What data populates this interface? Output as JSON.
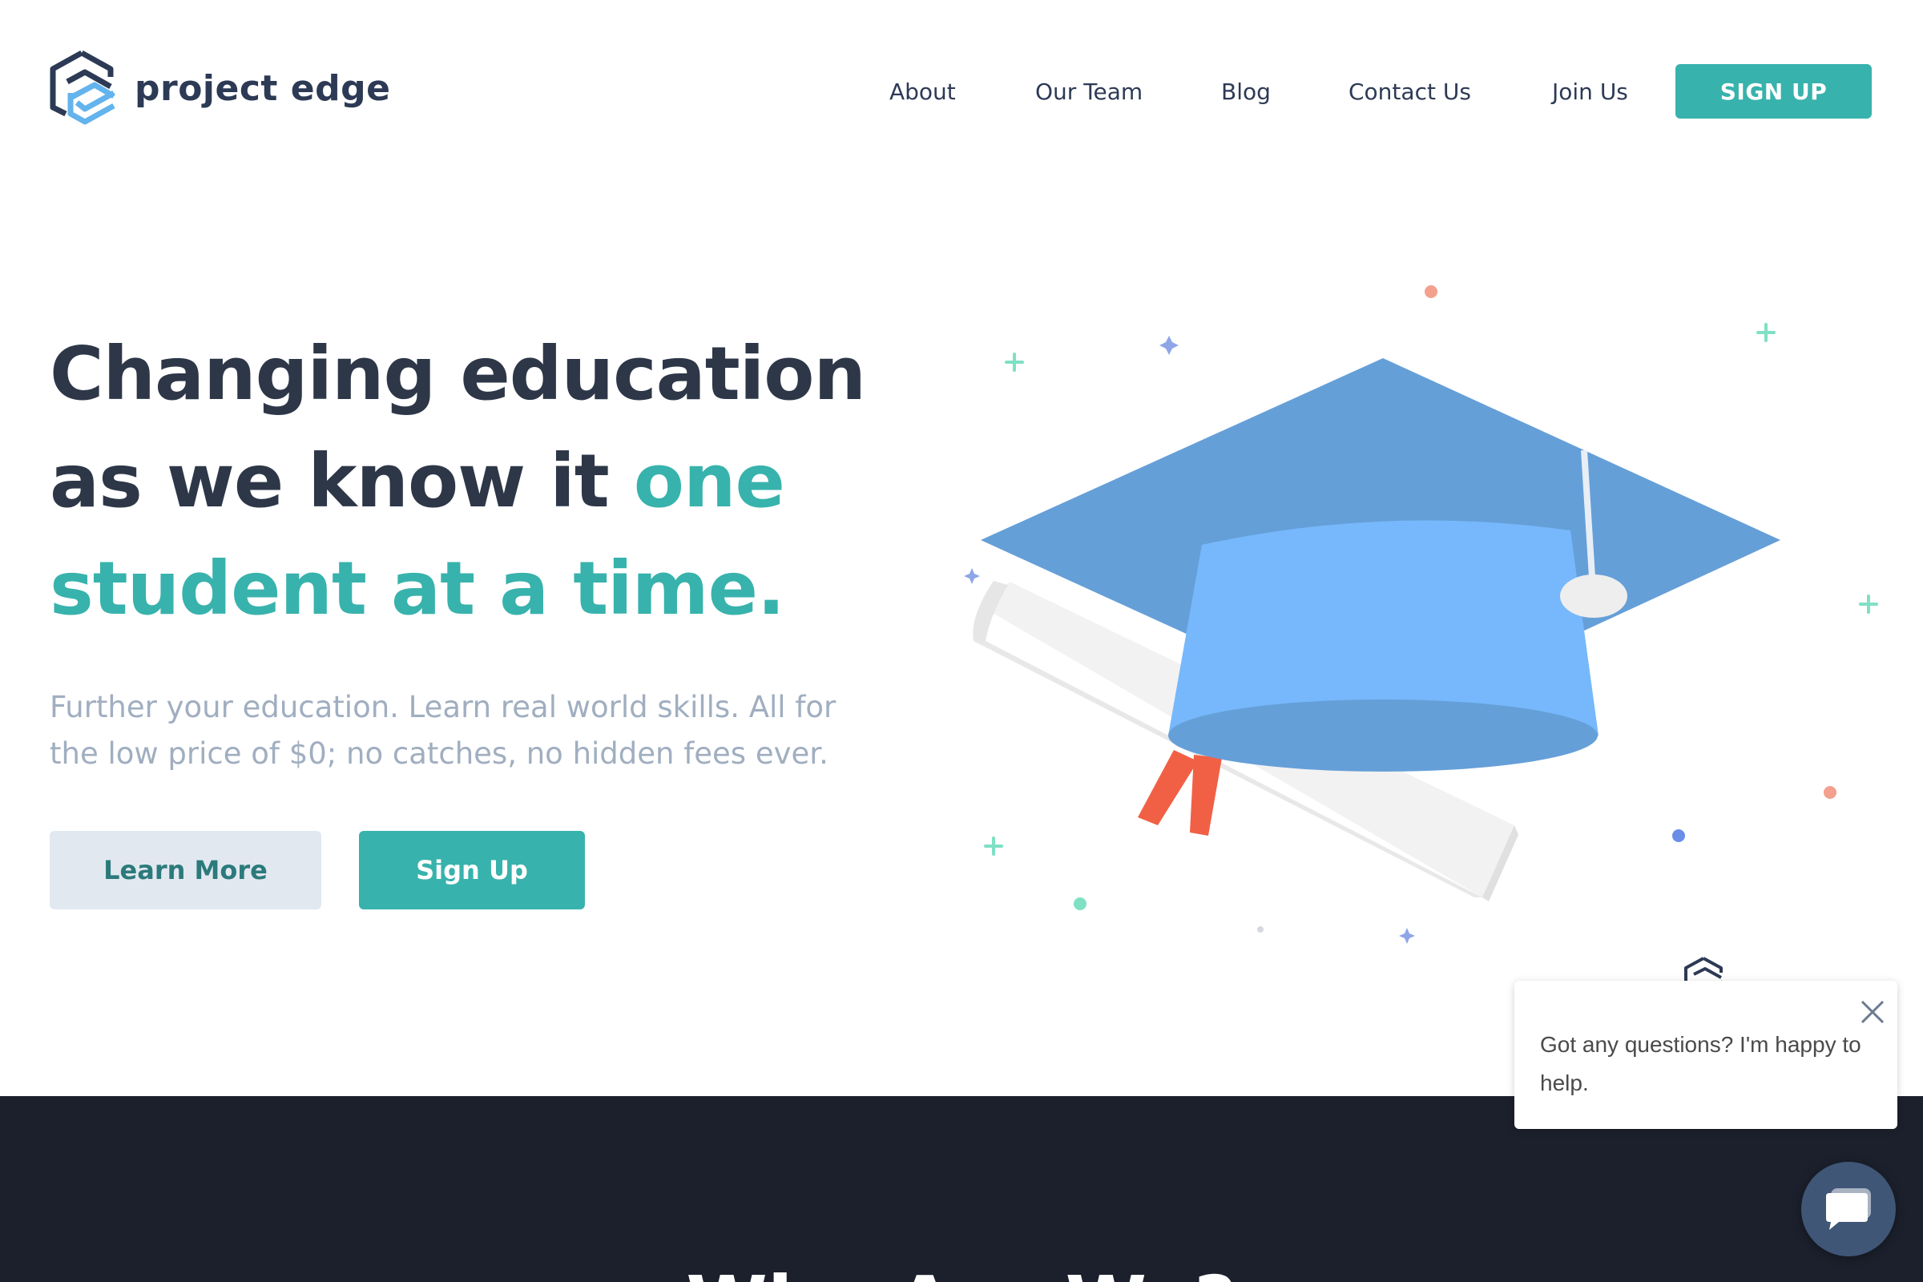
{
  "brand": {
    "name": "project edge",
    "colors": {
      "primary": "#38b2ac",
      "dark": "#2d3748",
      "navy": "#1b202c"
    }
  },
  "nav": {
    "links": [
      "About",
      "Our Team",
      "Blog",
      "Contact Us",
      "Join Us"
    ],
    "signup_label": "SIGN UP"
  },
  "hero": {
    "title_line1": "Changing education",
    "title_line2_plain": "as we know it ",
    "title_line2_accent": "one",
    "title_line3_accent": "student at a time.",
    "subtitle": "Further your education. Learn real world skills. All for the low price of $0; no catches, no hidden fees ever.",
    "learn_more_label": "Learn More",
    "sign_up_label": "Sign Up",
    "illustration_icon": "graduation-cap-with-diploma"
  },
  "section": {
    "title": "Who Are We?"
  },
  "chat": {
    "message": "Got any questions? I'm happy to help.",
    "close_icon": "close-icon",
    "launcher_icon": "chat-icon"
  }
}
